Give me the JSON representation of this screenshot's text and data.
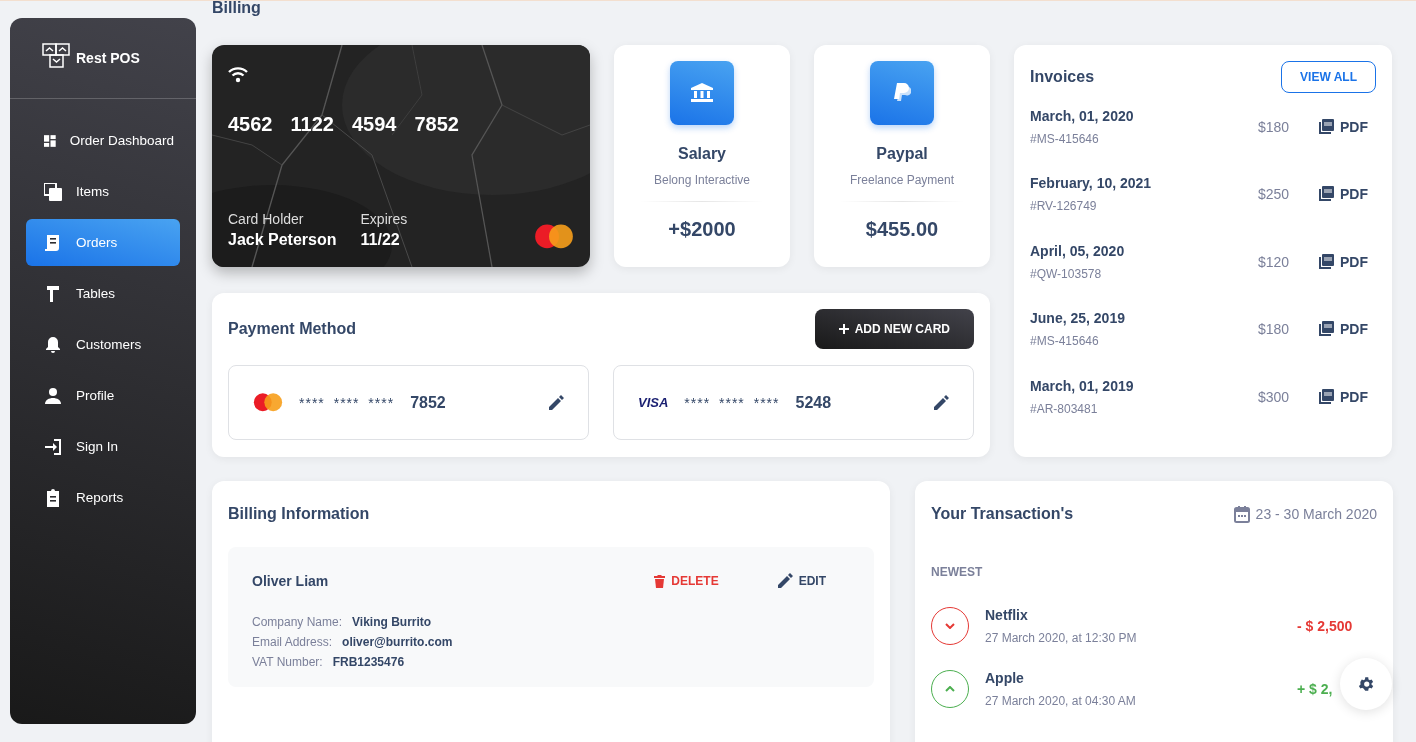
{
  "page_title": "Billing",
  "sidebar": {
    "brand": "Rest POS",
    "items": [
      {
        "label": "Order Dashboard",
        "selected": false
      },
      {
        "label": "Items",
        "selected": false
      },
      {
        "label": "Orders",
        "selected": true
      },
      {
        "label": "Tables",
        "selected": false
      },
      {
        "label": "Customers",
        "selected": false
      },
      {
        "label": "Profile",
        "selected": false
      },
      {
        "label": "Sign In",
        "selected": false
      },
      {
        "label": "Reports",
        "selected": false
      }
    ]
  },
  "credit_card": {
    "number_groups": [
      "4562",
      "1122",
      "4594",
      "7852"
    ],
    "holder_label": "Card Holder",
    "holder": "Jack Peterson",
    "expires_label": "Expires",
    "expires": "11/22"
  },
  "stats": [
    {
      "title": "Salary",
      "subtitle": "Belong Interactive",
      "value": "+$2000"
    },
    {
      "title": "Paypal",
      "subtitle": "Freelance Payment",
      "value": "$455.00"
    }
  ],
  "payment_method": {
    "title": "Payment Method",
    "button": "ADD NEW CARD",
    "cards": [
      {
        "kind": "mastercard",
        "mask": "**** **** ****",
        "last4": "7852"
      },
      {
        "kind": "visa",
        "logo": "VISA",
        "mask": "**** **** ****",
        "last4": "5248"
      }
    ]
  },
  "invoices": {
    "title": "Invoices",
    "button": "VIEW ALL",
    "rows": [
      {
        "date": "March, 01, 2020",
        "id": "#MS-415646",
        "amount": "$180",
        "link": "PDF"
      },
      {
        "date": "February, 10, 2021",
        "id": "#RV-126749",
        "amount": "$250",
        "link": "PDF"
      },
      {
        "date": "April, 05, 2020",
        "id": "#QW-103578",
        "amount": "$120",
        "link": "PDF"
      },
      {
        "date": "June, 25, 2019",
        "id": "#MS-415646",
        "amount": "$180",
        "link": "PDF"
      },
      {
        "date": "March, 01, 2019",
        "id": "#AR-803481",
        "amount": "$300",
        "link": "PDF"
      }
    ]
  },
  "billing_information": {
    "title": "Billing Information",
    "entries": [
      {
        "name": "Oliver Liam",
        "delete": "DELETE",
        "edit": "EDIT",
        "fields": [
          {
            "label": "Company Name:",
            "value": "Viking Burrito"
          },
          {
            "label": "Email Address:",
            "value": "oliver@burrito.com"
          },
          {
            "label": "VAT Number:",
            "value": "FRB1235476"
          }
        ]
      }
    ]
  },
  "transactions": {
    "title": "Your Transaction's",
    "date_range": "23 - 30 March 2020",
    "section": "NEWEST",
    "items": [
      {
        "kind": "debit",
        "name": "Netflix",
        "time": "27 March 2020, at 12:30 PM",
        "amount": "- $ 2,500"
      },
      {
        "kind": "credit",
        "name": "Apple",
        "time": "27 March 2020, at 04:30 AM",
        "amount": "+ $ 2,"
      }
    ]
  }
}
